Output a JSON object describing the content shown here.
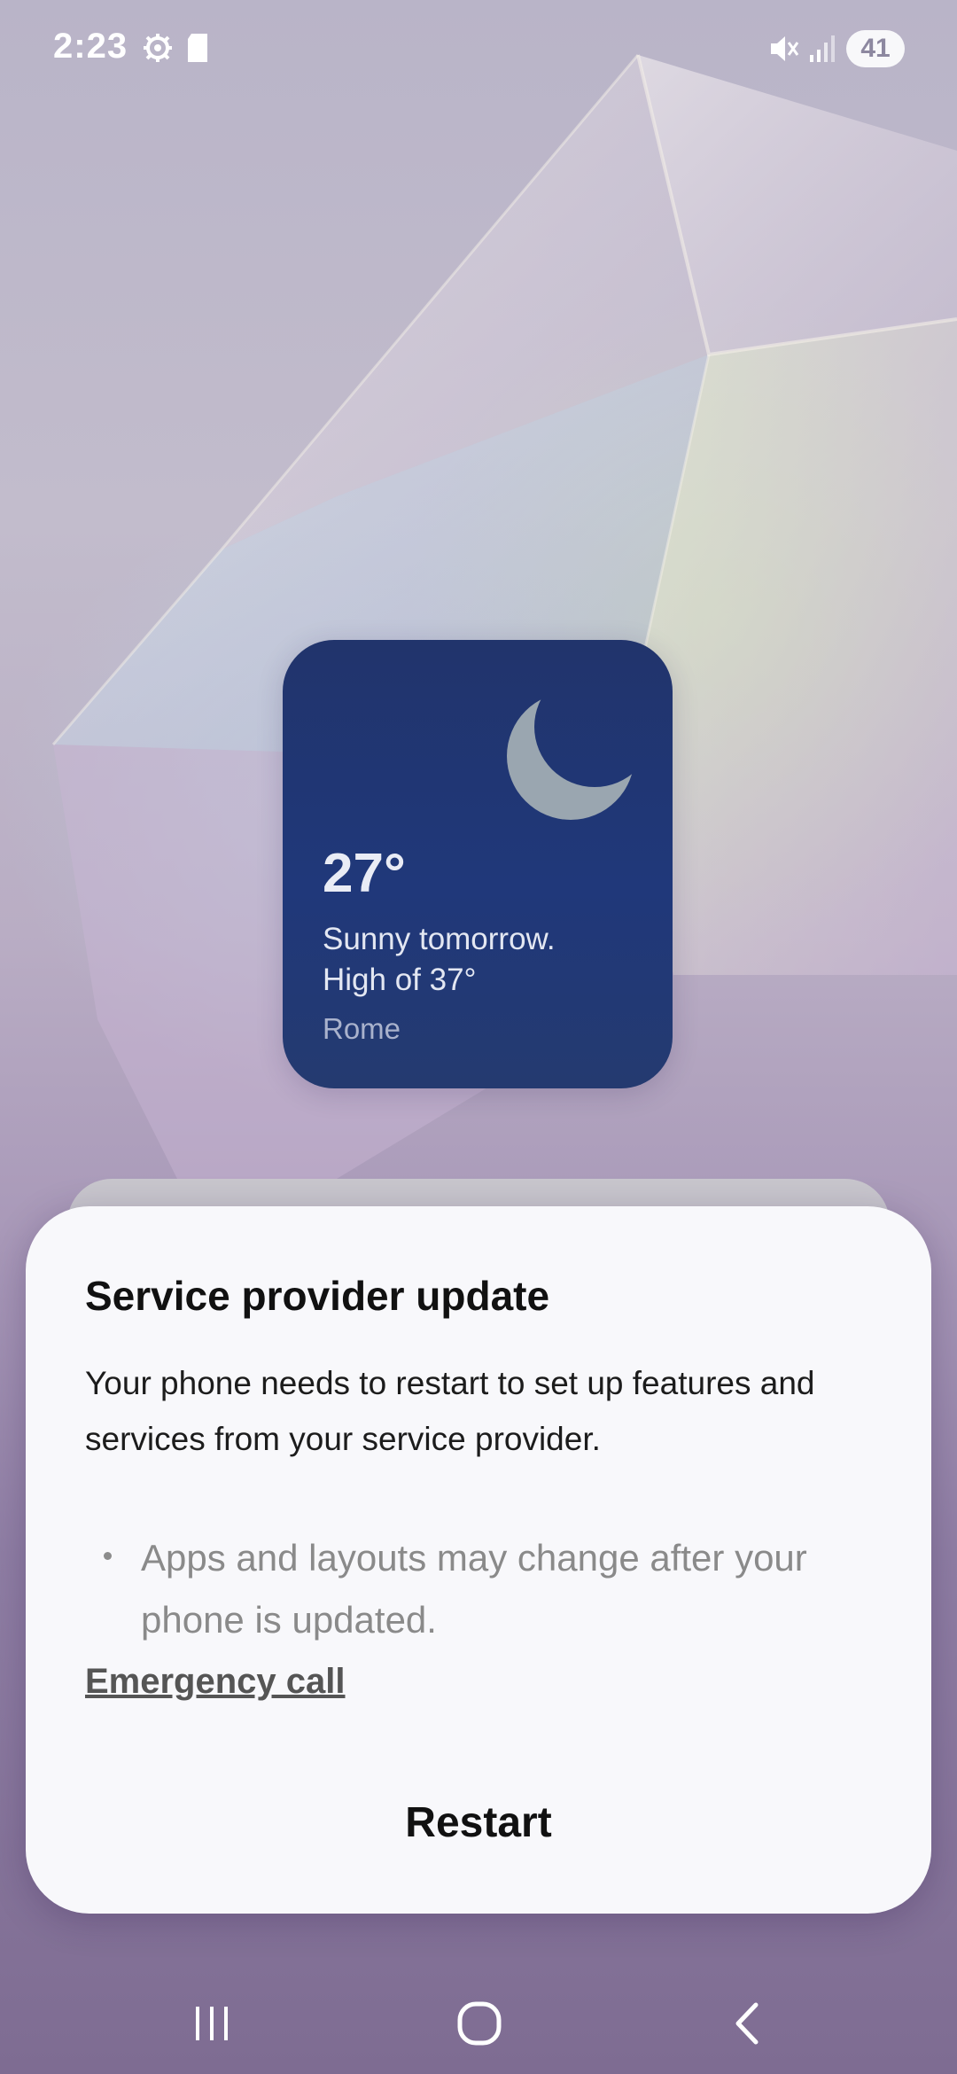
{
  "status_bar": {
    "time": "2:23",
    "battery_level": "41",
    "icons": [
      "settings-icon",
      "sd-card-icon",
      "mute-icon",
      "signal-icon",
      "battery-icon"
    ]
  },
  "weather_widget": {
    "temperature": "27°",
    "forecast_line1": "Sunny tomorrow.",
    "forecast_line2": "High of 37°",
    "city": "Rome",
    "icon": "moon-icon"
  },
  "dialog": {
    "title": "Service provider update",
    "body": "Your phone needs to restart to set up features and services from your service provider.",
    "bullet": "Apps and layouts may change after your phone is updated.",
    "emergency_link": "Emergency call",
    "restart_button": "Restart"
  },
  "nav_bar": {
    "buttons": [
      "recent-apps-icon",
      "home-icon",
      "back-icon"
    ]
  },
  "colors": {
    "widget_bg": "#20387a",
    "dialog_bg": "#f8f8fb"
  }
}
